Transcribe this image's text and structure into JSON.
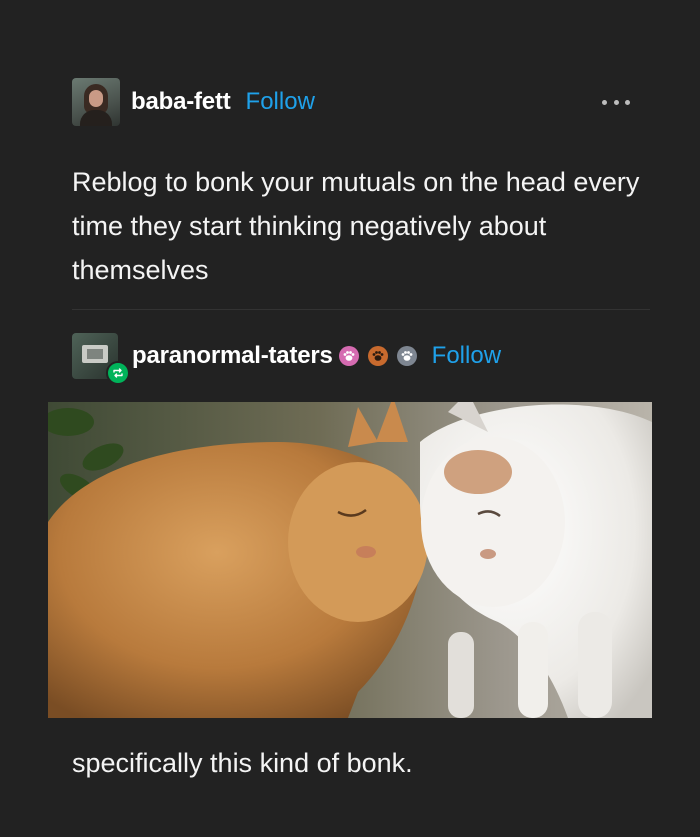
{
  "original_post": {
    "username": "baba-fett",
    "follow_label": "Follow",
    "text": "Reblog to bonk your mutuals on the head every time they start thinking negatively about themselves"
  },
  "reblog": {
    "username": "paranormal-taters",
    "follow_label": "Follow",
    "badges": [
      "paw-badge-pink",
      "paw-badge-orange",
      "paw-badge-gray"
    ],
    "caption": "specifically this kind of bonk."
  },
  "colors": {
    "background": "#222222",
    "follow_link": "#1fa1ea",
    "reblog_badge": "#00b35a"
  }
}
